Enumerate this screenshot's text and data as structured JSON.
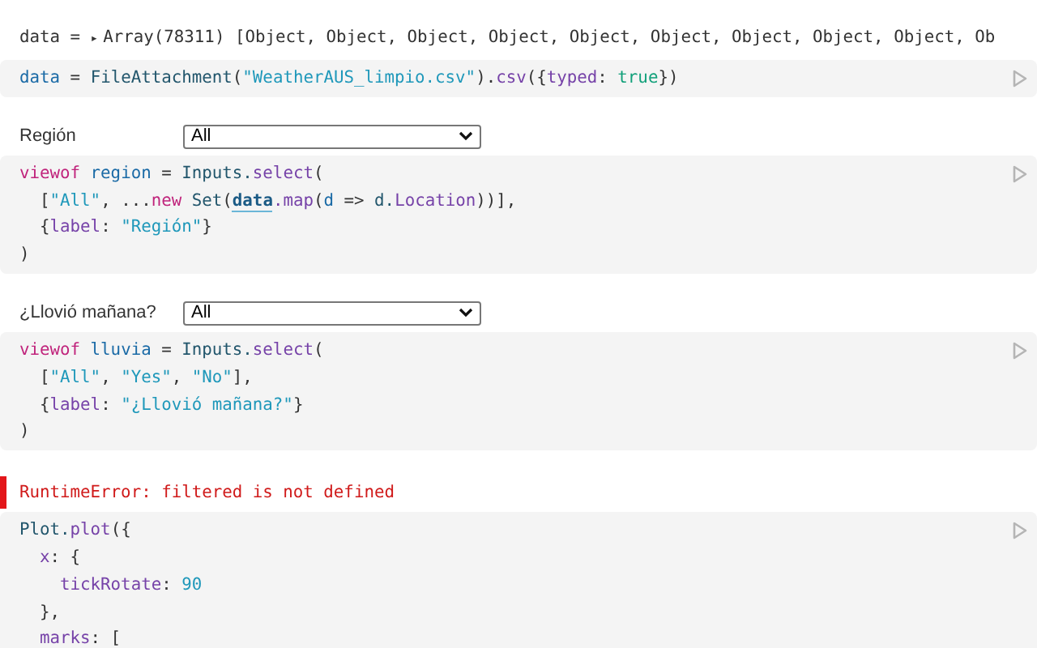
{
  "cells": [
    {
      "output": {
        "kind": "inspector",
        "name": "data = ",
        "toggle": "▸",
        "value": "Array(78311) [Object, Object, Object, Object, Object, Object, Object, Object, Object, Ob"
      },
      "code": [
        [
          {
            "kind": "def",
            "text": "data"
          },
          {
            "kind": "plain",
            "text": " = "
          },
          {
            "kind": "var",
            "text": "FileAttachment"
          },
          {
            "kind": "plain",
            "text": "("
          },
          {
            "kind": "str",
            "text": "\"WeatherAUS_limpio.csv\""
          },
          {
            "kind": "plain",
            "text": ")."
          },
          {
            "kind": "prop",
            "text": "csv"
          },
          {
            "kind": "plain",
            "text": "({"
          },
          {
            "kind": "prop",
            "text": "typed"
          },
          {
            "kind": "plain",
            "text": ": "
          },
          {
            "kind": "atom",
            "text": "true"
          },
          {
            "kind": "plain",
            "text": "})"
          }
        ]
      ]
    },
    {
      "output": {
        "kind": "select",
        "label": "Región",
        "value": "All"
      },
      "code": [
        [
          {
            "kind": "kw",
            "text": "viewof "
          },
          {
            "kind": "def",
            "text": "region"
          },
          {
            "kind": "plain",
            "text": " = "
          },
          {
            "kind": "var",
            "text": "Inputs."
          },
          {
            "kind": "prop",
            "text": "select"
          },
          {
            "kind": "plain",
            "text": "("
          }
        ],
        [
          {
            "kind": "plain",
            "text": "  ["
          },
          {
            "kind": "str",
            "text": "\"All\""
          },
          {
            "kind": "plain",
            "text": ", ..."
          },
          {
            "kind": "kw",
            "text": "new "
          },
          {
            "kind": "var",
            "text": "Set"
          },
          {
            "kind": "plain",
            "text": "("
          },
          {
            "kind": "ref",
            "text": "data"
          },
          {
            "kind": "prop",
            "text": ".map"
          },
          {
            "kind": "plain",
            "text": "("
          },
          {
            "kind": "def",
            "text": "d"
          },
          {
            "kind": "plain",
            "text": " => "
          },
          {
            "kind": "var",
            "text": "d."
          },
          {
            "kind": "prop",
            "text": "Location"
          },
          {
            "kind": "plain",
            "text": "))],"
          }
        ],
        [
          {
            "kind": "plain",
            "text": "  {"
          },
          {
            "kind": "prop",
            "text": "label"
          },
          {
            "kind": "plain",
            "text": ": "
          },
          {
            "kind": "str",
            "text": "\"Región\""
          },
          {
            "kind": "plain",
            "text": "}"
          }
        ],
        [
          {
            "kind": "plain",
            "text": ")"
          }
        ]
      ]
    },
    {
      "output": {
        "kind": "select",
        "label": "¿Llovió mañana?",
        "value": "All"
      },
      "code": [
        [
          {
            "kind": "kw",
            "text": "viewof "
          },
          {
            "kind": "def",
            "text": "lluvia"
          },
          {
            "kind": "plain",
            "text": " = "
          },
          {
            "kind": "var",
            "text": "Inputs."
          },
          {
            "kind": "prop",
            "text": "select"
          },
          {
            "kind": "plain",
            "text": "("
          }
        ],
        [
          {
            "kind": "plain",
            "text": "  ["
          },
          {
            "kind": "str",
            "text": "\"All\""
          },
          {
            "kind": "plain",
            "text": ", "
          },
          {
            "kind": "str",
            "text": "\"Yes\""
          },
          {
            "kind": "plain",
            "text": ", "
          },
          {
            "kind": "str",
            "text": "\"No\""
          },
          {
            "kind": "plain",
            "text": "],"
          }
        ],
        [
          {
            "kind": "plain",
            "text": "  {"
          },
          {
            "kind": "prop",
            "text": "label"
          },
          {
            "kind": "plain",
            "text": ": "
          },
          {
            "kind": "str",
            "text": "\"¿Llovió mañana?\""
          },
          {
            "kind": "plain",
            "text": "}"
          }
        ],
        [
          {
            "kind": "plain",
            "text": ")"
          }
        ]
      ]
    },
    {
      "output": {
        "kind": "error",
        "message": "RuntimeError: filtered is not defined"
      },
      "code": [
        [
          {
            "kind": "var",
            "text": "Plot."
          },
          {
            "kind": "prop",
            "text": "plot"
          },
          {
            "kind": "plain",
            "text": "({"
          }
        ],
        [
          {
            "kind": "prop",
            "text": "  x"
          },
          {
            "kind": "plain",
            "text": ": {"
          }
        ],
        [
          {
            "kind": "prop",
            "text": "    tickRotate"
          },
          {
            "kind": "plain",
            "text": ": "
          },
          {
            "kind": "num",
            "text": "90"
          }
        ],
        [
          {
            "kind": "plain",
            "text": "  },"
          }
        ],
        [
          {
            "kind": "prop",
            "text": "  marks"
          },
          {
            "kind": "plain",
            "text": ": ["
          }
        ]
      ]
    }
  ]
}
